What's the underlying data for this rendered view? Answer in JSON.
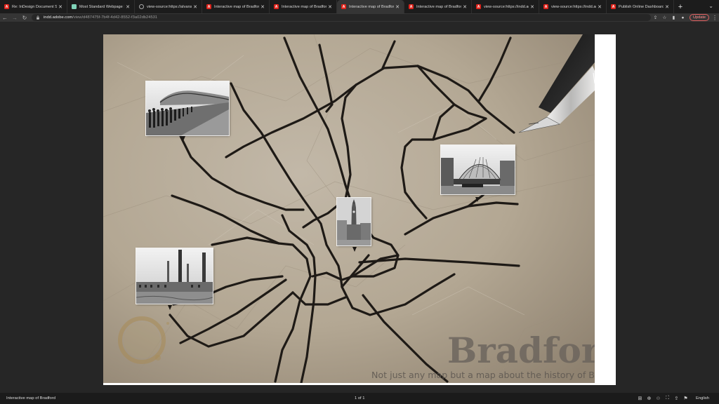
{
  "tabs": [
    {
      "title": "Re: InDesign Document Setup",
      "icon": "adobe",
      "active": false
    },
    {
      "title": "Most Standard Webpage Size",
      "icon": "sheet",
      "active": false
    },
    {
      "title": "view-source:https://alvanstrip",
      "icon": "globe",
      "active": false
    },
    {
      "title": "Interactive map of Bradford",
      "icon": "adobe",
      "active": false
    },
    {
      "title": "Interactive map of Bradford",
      "icon": "adobe",
      "active": false
    },
    {
      "title": "Interactive map of Bradford",
      "icon": "adobe",
      "active": true
    },
    {
      "title": "Interactive map of Bradford",
      "icon": "adobe",
      "active": false
    },
    {
      "title": "view-source:https://indd.adob",
      "icon": "adobe",
      "active": false
    },
    {
      "title": "view-source:https://indd.adob",
      "icon": "adobe",
      "active": false
    },
    {
      "title": "Publish Online Dashboard",
      "icon": "adobe",
      "active": false
    }
  ],
  "address": {
    "host": "indd.adobe.com",
    "path": "/view/d487475f-7b4f-4d42-8552-f3a02db24531"
  },
  "toolbar": {
    "update_label": "Update"
  },
  "document": {
    "title_word": "Bradford",
    "tagline": "Not just any map but a map about the history of Bradford"
  },
  "bottombar": {
    "doc_title": "Interactive map of Bradford",
    "page_indicator": "1 of 1",
    "language": "English"
  },
  "colors": {
    "paper": "#b9ad9b",
    "road": "#1e1a16",
    "title_text": "#6a635c",
    "update_accent": "#e06060",
    "adobe_red": "#e0231b"
  },
  "icons": [
    "back-icon",
    "forward-icon",
    "reload-icon",
    "lock-icon",
    "share-icon",
    "star-icon",
    "sidepanel-icon",
    "profile-icon",
    "grid-icon",
    "zoom-in-icon",
    "zoom-out-icon",
    "fit-page-icon",
    "share-doc-icon",
    "flag-icon",
    "fountain-pen-icon",
    "map-pin-icon"
  ]
}
